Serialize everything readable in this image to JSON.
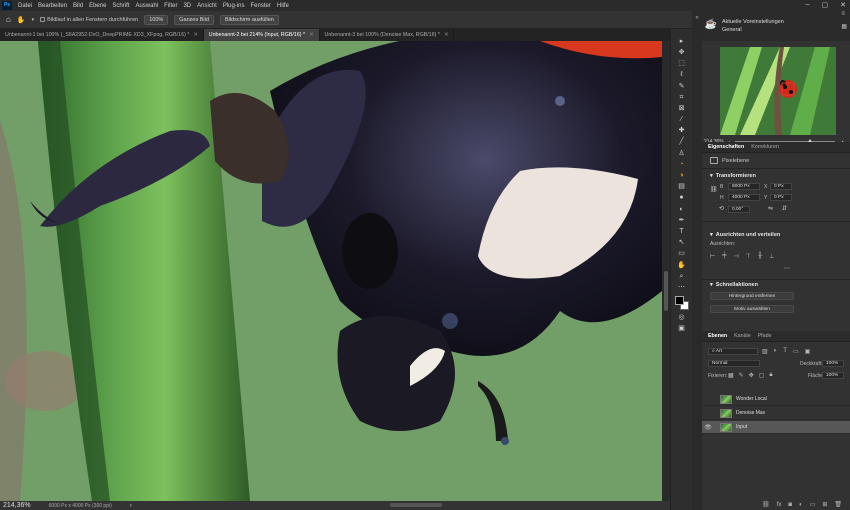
{
  "menu": {
    "app_icon": "Ps",
    "items": [
      "Datei",
      "Bearbeiten",
      "Bild",
      "Ebene",
      "Schrift",
      "Auswahl",
      "Filter",
      "3D",
      "Ansicht",
      "Plug-ins",
      "Fenster",
      "Hilfe"
    ],
    "window_controls": [
      "minimize-icon",
      "maximize-icon",
      "close-icon"
    ]
  },
  "options": {
    "tool_icon": "hand-icon",
    "scroll_all_label": "Bildlauf in allen Fenstern durchführen",
    "btn_100": "100%",
    "btn_fit": "Ganzes Bild",
    "btn_fill": "Bildschirm ausfüllen"
  },
  "tabs": [
    {
      "label": "Unbenannt-1 bei 100% (_S6A2952-DxO_DeepPRIME XD3_XFpog, RGB/16) *",
      "active": false
    },
    {
      "label": "Unbenannt-2 bei 214% (Input, RGB/16) *",
      "active": true
    },
    {
      "label": "Unbenannt-3 bei 100% (Denoise Max, RGB/16) *",
      "active": false
    }
  ],
  "status": {
    "zoom": "214,36%",
    "doc_info": "6000 Px x 4000 Px (300 ppi)"
  },
  "learn": {
    "title": "Aktuelle Voreinstellungen",
    "subtitle": "General"
  },
  "navigator": {
    "zoom": "214,36%",
    "zoom_percent": 74
  },
  "properties": {
    "tabs": [
      "Eigenschaften",
      "Korrekturen"
    ],
    "layer_type": "Pixelebene",
    "transform_heading": "Transformieren",
    "w_label": "B",
    "w_value": "6000 Px",
    "h_label": "H",
    "h_value": "4000 Px",
    "x_label": "X",
    "x_value": "0 Px",
    "y_label": "Y",
    "y_value": "0 Px",
    "angle_value": "0,00°",
    "align_heading": "Ausrichten und verteilen",
    "align_sub": "Ausrichten:",
    "quick_heading": "Schnellaktionen",
    "quick_remove_bg": "Hintergrund entfernen",
    "quick_select_subject": "Motiv auswählen"
  },
  "layers_panel": {
    "tabs": [
      "Ebenen",
      "Kanäle",
      "Pfade"
    ],
    "kind": "Art",
    "blend_mode": "Normal",
    "opacity_label": "Deckkraft:",
    "opacity": "100%",
    "lock_label": "Fixieren:",
    "fill_label": "Fläche:",
    "fill": "100%",
    "items": [
      {
        "name": "Wonder Local",
        "visible": false,
        "selected": false
      },
      {
        "name": "Denoise Max",
        "visible": false,
        "selected": false
      },
      {
        "name": "Input",
        "visible": true,
        "selected": true
      }
    ]
  },
  "tools": [
    "play-icon",
    "move-icon",
    "marquee-icon",
    "lasso-icon",
    "quick-select-icon",
    "crop-icon",
    "frame-icon",
    "eyedropper-icon",
    "spot-heal-icon",
    "brush-icon",
    "stamp-icon",
    "history-brush-icon",
    "eraser-icon",
    "gradient-icon",
    "blur-icon",
    "dodge-icon",
    "pen-icon",
    "type-icon",
    "path-select-icon",
    "shape-icon",
    "hand-icon",
    "zoom-icon",
    "more-icon"
  ],
  "colors": {
    "accent_active_tab": "#424242",
    "canvas_bg": "#6f9a67",
    "selected_layer": "#575757"
  }
}
